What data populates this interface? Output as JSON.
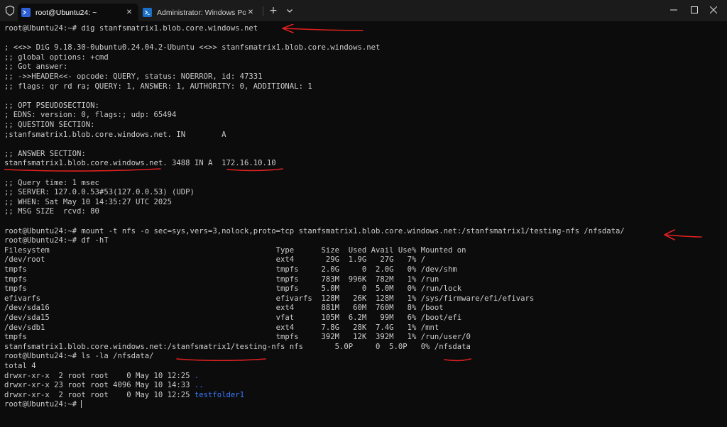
{
  "tabs": [
    {
      "label": "root@Ubuntu24: ~",
      "icon": "terminal-icon",
      "active": true
    },
    {
      "label": "Administrator: Windows Powe",
      "icon": "powershell-icon",
      "active": false
    }
  ],
  "new_tab_label": "+",
  "terminal": {
    "lines": [
      "root@Ubuntu24:~# dig stanfsmatrix1.blob.core.windows.net",
      "",
      "; <<>> DiG 9.18.30-0ubuntu0.24.04.2-Ubuntu <<>> stanfsmatrix1.blob.core.windows.net",
      ";; global options: +cmd",
      ";; Got answer:",
      ";; ->>HEADER<<- opcode: QUERY, status: NOERROR, id: 47331",
      ";; flags: qr rd ra; QUERY: 1, ANSWER: 1, AUTHORITY: 0, ADDITIONAL: 1",
      "",
      ";; OPT PSEUDOSECTION:",
      "; EDNS: version: 0, flags:; udp: 65494",
      ";; QUESTION SECTION:",
      ";stanfsmatrix1.blob.core.windows.net. IN        A",
      "",
      ";; ANSWER SECTION:",
      "stanfsmatrix1.blob.core.windows.net. 3488 IN A  172.16.10.10",
      "",
      ";; Query time: 1 msec",
      ";; SERVER: 127.0.0.53#53(127.0.0.53) (UDP)",
      ";; WHEN: Sat May 10 14:35:27 UTC 2025",
      ";; MSG SIZE  rcvd: 80",
      "",
      "root@Ubuntu24:~# mount -t nfs -o sec=sys,vers=3,nolock,proto=tcp stanfsmatrix1.blob.core.windows.net:/stanfsmatrix1/testing-nfs /nfsdata/",
      "root@Ubuntu24:~# df -hT",
      "Filesystem                                                  Type      Size  Used Avail Use% Mounted on",
      "/dev/root                                                   ext4       29G  1.9G   27G   7% /",
      "tmpfs                                                       tmpfs     2.0G     0  2.0G   0% /dev/shm",
      "tmpfs                                                       tmpfs     783M  996K  782M   1% /run",
      "tmpfs                                                       tmpfs     5.0M     0  5.0M   0% /run/lock",
      "efivarfs                                                    efivarfs  128M   26K  128M   1% /sys/firmware/efi/efivars",
      "/dev/sda16                                                  ext4      881M   60M  760M   8% /boot",
      "/dev/sda15                                                  vfat      105M  6.2M   99M   6% /boot/efi",
      "/dev/sdb1                                                   ext4      7.8G   28K  7.4G   1% /mnt",
      "tmpfs                                                       tmpfs     392M   12K  392M   1% /run/user/0",
      "stanfsmatrix1.blob.core.windows.net:/stanfsmatrix1/testing-nfs nfs       5.0P     0  5.0P   0% /nfsdata",
      "root@Ubuntu24:~# ls -la /nfsdata/",
      "total 4"
    ],
    "ls_rows": [
      {
        "prefix": "drwxr-xr-x  2 root root    0 May 10 12:25 ",
        "name": "."
      },
      {
        "prefix": "drwxr-xr-x 23 root root 4096 May 10 14:33 ",
        "name": ".."
      },
      {
        "prefix": "drwxr-xr-x  2 root root    0 May 10 12:25 ",
        "name": "testfolder1"
      }
    ],
    "prompt": "root@Ubuntu24:~# ",
    "colors": {
      "directory": "#3b78ff",
      "annotation": "#e02020",
      "text": "#cccccc",
      "background": "#0c0c0c"
    }
  }
}
